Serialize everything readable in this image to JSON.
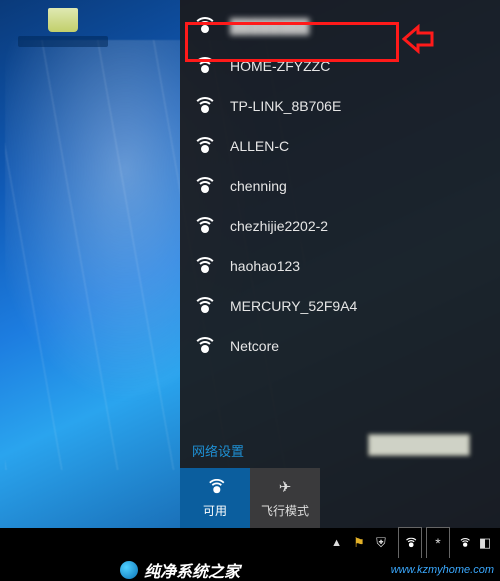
{
  "desktop": {
    "recycle_label": ""
  },
  "flyout": {
    "networks": [
      {
        "ssid": "████████",
        "blurred": true
      },
      {
        "ssid": "HOME-ZFYZZC"
      },
      {
        "ssid": "TP-LINK_8B706E"
      },
      {
        "ssid": "ALLEN-C"
      },
      {
        "ssid": "chenning"
      },
      {
        "ssid": "chezhijie2202-2"
      },
      {
        "ssid": "haohao123"
      },
      {
        "ssid": "MERCURY_52F9A4"
      },
      {
        "ssid": "Netcore"
      }
    ],
    "settings_label": "网络设置",
    "tiles": {
      "wlan": {
        "label": "可用",
        "active": true
      },
      "airplane": {
        "label": "飞行模式",
        "active": false
      }
    }
  },
  "taskbar": {
    "tray": [
      "expand",
      "flag",
      "shield",
      "wifi",
      "asterisk",
      "wifi2",
      "notify"
    ]
  },
  "watermark": {
    "brand": "纯净系统之家",
    "url": "www.kzmyhome.com"
  },
  "annotation": {
    "highlight_index": 0
  }
}
